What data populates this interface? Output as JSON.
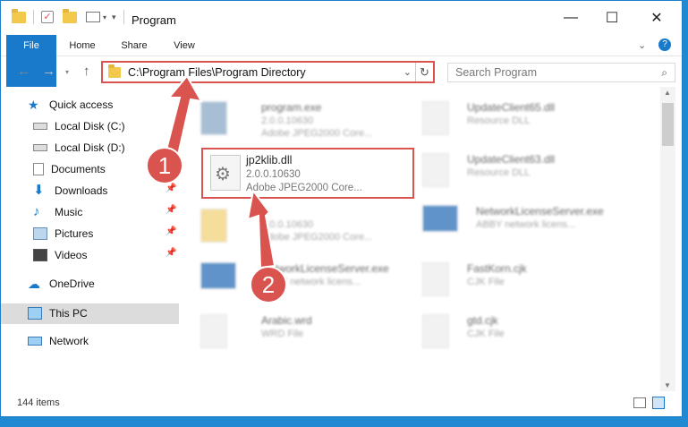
{
  "window": {
    "title": "Program",
    "controls": {
      "minimize": "—",
      "maximize": "☐",
      "close": "✕"
    }
  },
  "ribbon": {
    "tabs": [
      "File",
      "Home",
      "Share",
      "View"
    ]
  },
  "address": {
    "path": "C:\\Program Files\\Program Directory",
    "search_placeholder": "Search Program"
  },
  "sidebar": {
    "items": [
      {
        "label": "Quick access",
        "icon": "star-icon",
        "pinned": false
      },
      {
        "label": "Local Disk (C:)",
        "icon": "drive-icon",
        "pinned": false
      },
      {
        "label": "Local Disk (D:)",
        "icon": "drive-icon",
        "pinned": false
      },
      {
        "label": "Documents",
        "icon": "document-icon",
        "pinned": true
      },
      {
        "label": "Downloads",
        "icon": "download-icon",
        "pinned": true
      },
      {
        "label": "Music",
        "icon": "music-icon",
        "pinned": true
      },
      {
        "label": "Pictures",
        "icon": "picture-icon",
        "pinned": true
      },
      {
        "label": "Videos",
        "icon": "video-icon",
        "pinned": true
      },
      {
        "label": "OneDrive",
        "icon": "cloud-icon",
        "pinned": false
      },
      {
        "label": "This PC",
        "icon": "computer-icon",
        "pinned": false
      },
      {
        "label": "Network",
        "icon": "network-icon",
        "pinned": false
      }
    ]
  },
  "files": [
    {
      "name": "program.exe",
      "line2": "2.0.0.10630",
      "line3": "Adobe JPEG2000 Core..."
    },
    {
      "name": "UpdateClient65.dll",
      "line2": "Resource DLL",
      "line3": ""
    },
    {
      "name": "jp2klib.dll",
      "line2": "2.0.0.10630",
      "line3": "Adobe JPEG2000 Core..."
    },
    {
      "name": "UpdateClient63.dll",
      "line2": "Resource DLL",
      "line3": ""
    },
    {
      "name": "",
      "line2": "2.0.0.10630",
      "line3": "Adobe JPEG2000 Core..."
    },
    {
      "name": "NetworkLicenseServer.exe",
      "line2": "ABBY network licens...",
      "line3": ""
    },
    {
      "name": "NetworkLicenseServer.exe",
      "line2": "ABBY network licens...",
      "line3": ""
    },
    {
      "name": "FastKorn.cjk",
      "line2": "CJK File",
      "line3": ""
    },
    {
      "name": "Arabic.wrd",
      "line2": "WRD File",
      "line3": ""
    },
    {
      "name": "gtd.cjk",
      "line2": "CJK File",
      "line3": ""
    }
  ],
  "status": {
    "item_count": "144 items"
  },
  "callouts": [
    "1",
    "2"
  ],
  "colors": {
    "accent": "#1979ca",
    "highlight": "#d9534f",
    "desktop": "#1f8ad1"
  }
}
